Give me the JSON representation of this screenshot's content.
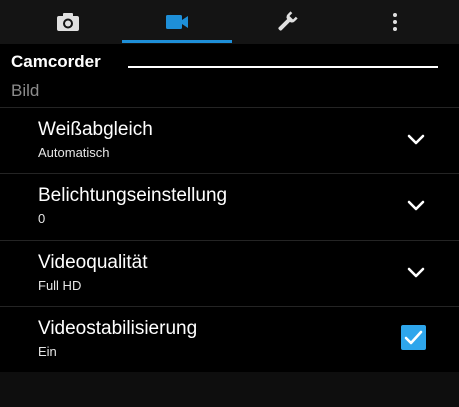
{
  "tabs": [
    {
      "icon": "camera-icon",
      "active": false
    },
    {
      "icon": "video-camera-icon",
      "active": true
    },
    {
      "icon": "wrench-icon",
      "active": false
    },
    {
      "icon": "more-vertical-icon",
      "active": false
    }
  ],
  "colors": {
    "accent": "#1e8fd8",
    "checkbox": "#2ea6ec",
    "muted_text": "#8c8c8c",
    "background": "#000000"
  },
  "section": {
    "title": "Camcorder"
  },
  "subsection": {
    "title": "Bild"
  },
  "settings": [
    {
      "label": "Weißabgleich",
      "value": "Automatisch",
      "control": "dropdown"
    },
    {
      "label": "Belichtungseinstellung",
      "value": "0",
      "control": "dropdown"
    },
    {
      "label": "Videoqualität",
      "value": "Full HD",
      "control": "dropdown"
    },
    {
      "label": "Videostabilisierung",
      "value": "Ein",
      "control": "checkbox",
      "checked": true
    }
  ]
}
